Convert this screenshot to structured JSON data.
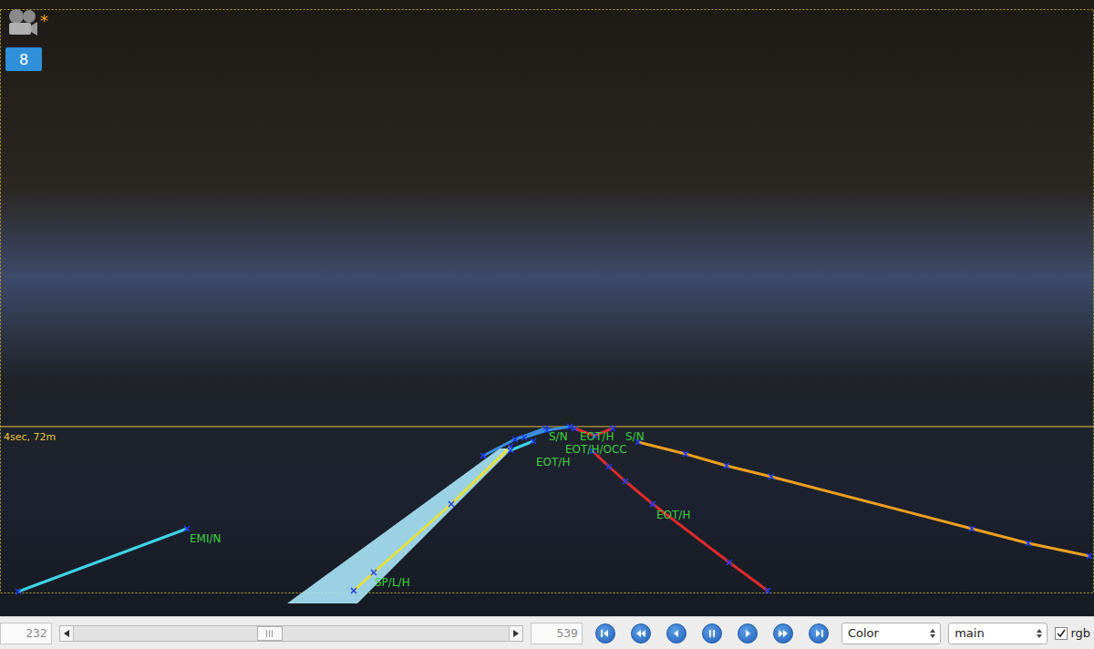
{
  "viewer": {
    "modified_mark": "*",
    "badge": "8",
    "horizon_label": "4sec, 72m"
  },
  "annotations": [
    {
      "label": "EMI/N",
      "kind": "line",
      "color": "#3fd3e6"
    },
    {
      "label": "SP/L/H",
      "kind": "band",
      "color": "#e6df3c"
    },
    {
      "label": "EOT/H",
      "kind": "line",
      "color": "#e02b2b"
    },
    {
      "label": "S/N",
      "kind": "line",
      "color": "#f0a020"
    },
    {
      "label": "EOT/H",
      "kind": "line",
      "color": "#3a8fe0"
    },
    {
      "label": "S/N",
      "kind": "line",
      "color": "#3a8fe0"
    },
    {
      "label": "EOT/H/OCC",
      "kind": "line",
      "color": "#e02b2b"
    },
    {
      "label": "EOT/H",
      "kind": "line",
      "color": "#3fd3e6"
    }
  ],
  "player": {
    "frame": "232",
    "total": "539",
    "position": 0.45,
    "selects": [
      {
        "value": "Color"
      },
      {
        "value": "main"
      }
    ],
    "rgb": {
      "label": "rgb",
      "checked": true
    }
  }
}
